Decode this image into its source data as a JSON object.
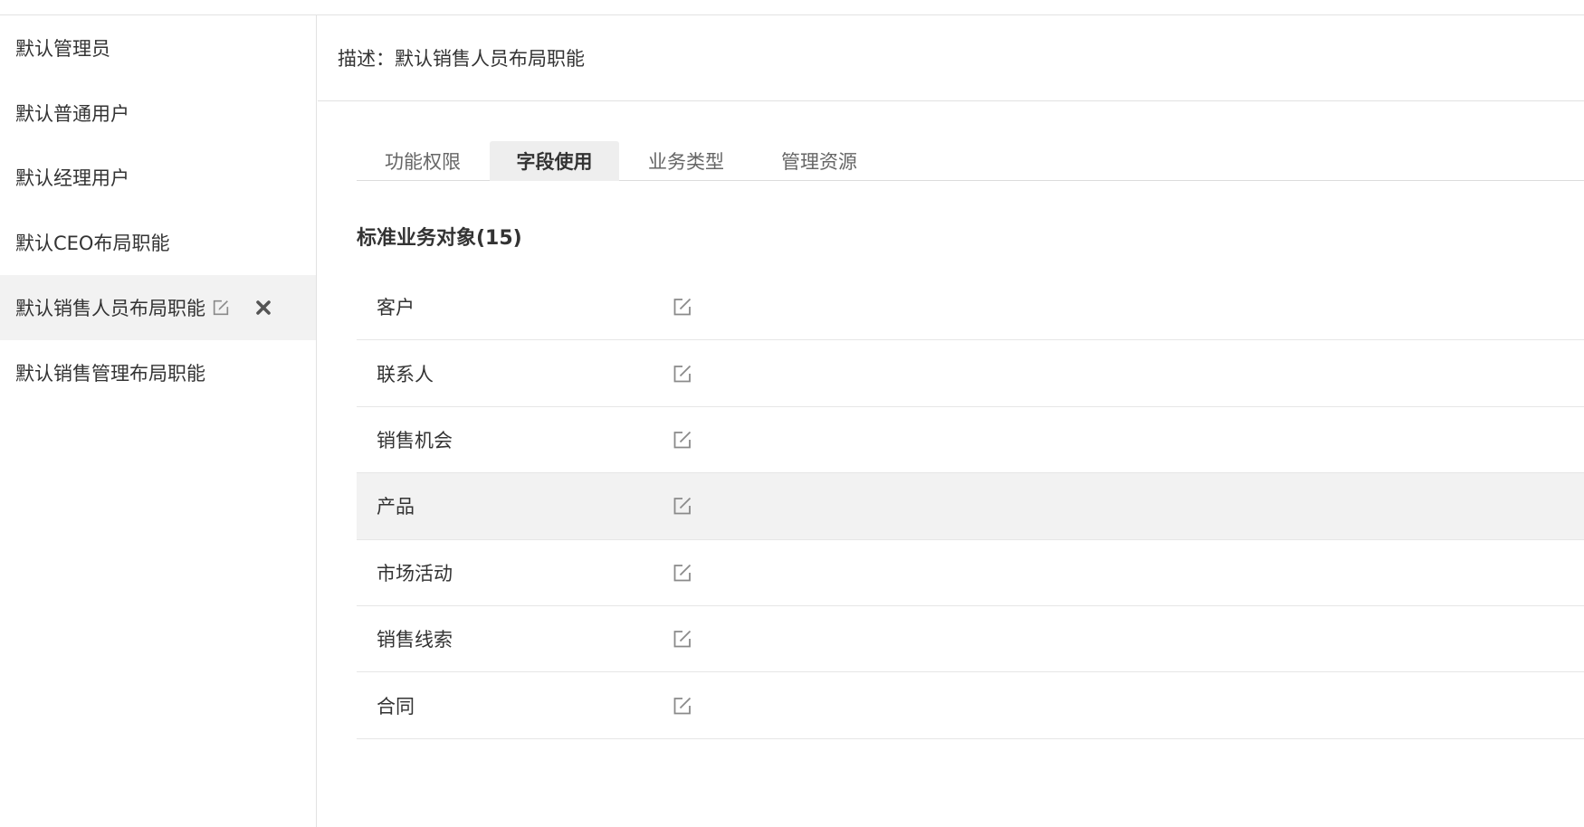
{
  "sidebar": {
    "items": [
      {
        "label": "默认管理员"
      },
      {
        "label": "默认普通用户"
      },
      {
        "label": "默认经理用户"
      },
      {
        "label": "默认CEO布局职能"
      },
      {
        "label": "默认销售人员布局职能",
        "active": true
      },
      {
        "label": "默认销售管理布局职能"
      }
    ]
  },
  "description": {
    "text": "描述：默认销售人员布局职能"
  },
  "tabs": [
    {
      "label": "功能权限"
    },
    {
      "label": "字段使用",
      "active": true
    },
    {
      "label": "业务类型"
    },
    {
      "label": "管理资源"
    }
  ],
  "section": {
    "title": "标准业务对象(15)"
  },
  "objects": [
    {
      "name": "客户",
      "icon": "edit-icon"
    },
    {
      "name": "联系人",
      "icon": "edit-icon"
    },
    {
      "name": "销售机会",
      "icon": "edit-icon"
    },
    {
      "name": "产品",
      "icon": "edit-icon",
      "highlighted": true
    },
    {
      "name": "市场活动",
      "icon": "edit-icon"
    },
    {
      "name": "销售线索",
      "icon": "edit-icon"
    },
    {
      "name": "合同",
      "icon": "edit-icon"
    }
  ],
  "colors": {
    "active_bg": "#f2f2f2",
    "border": "#e2e2e2",
    "text": "#333333",
    "muted_text": "#666666",
    "icon": "#8a8a8a"
  }
}
